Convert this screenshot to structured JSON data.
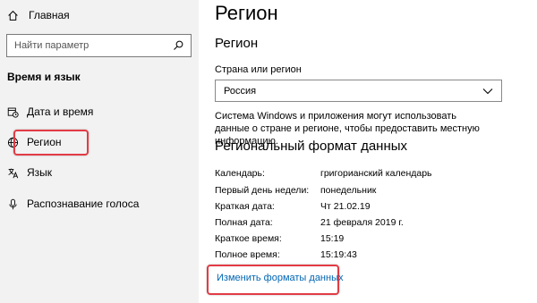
{
  "sidebar": {
    "home_label": "Главная",
    "search_placeholder": "Найти параметр",
    "section_title": "Время и язык",
    "items": [
      {
        "label": "Дата и время",
        "icon": "calendar-clock-icon"
      },
      {
        "label": "Регион",
        "icon": "globe-icon",
        "selected": true
      },
      {
        "label": "Язык",
        "icon": "language-icon"
      },
      {
        "label": "Распознавание голоса",
        "icon": "microphone-icon"
      }
    ]
  },
  "main": {
    "title": "Регион",
    "region_section_title": "Регион",
    "country_label": "Страна или регион",
    "country_value": "Россия",
    "description": "Система Windows и приложения могут использовать данные о стране и регионе, чтобы предоставить местную информацию.",
    "format_title": "Региональный формат данных",
    "formats": [
      {
        "key": "Календарь:",
        "value": "григорианский календарь"
      },
      {
        "key": "Первый день недели:",
        "value": "понедельник"
      },
      {
        "key": "Краткая дата:",
        "value": "Чт 21.02.19"
      },
      {
        "key": "Полная дата:",
        "value": "21 февраля 2019 г."
      },
      {
        "key": "Краткое время:",
        "value": "15:19"
      },
      {
        "key": "Полное время:",
        "value": "15:19:43"
      }
    ],
    "change_link": "Изменить форматы данных"
  },
  "colors": {
    "highlight": "#e23b45",
    "link": "#0066b4",
    "sidebar_bg": "#f2f2f2"
  }
}
